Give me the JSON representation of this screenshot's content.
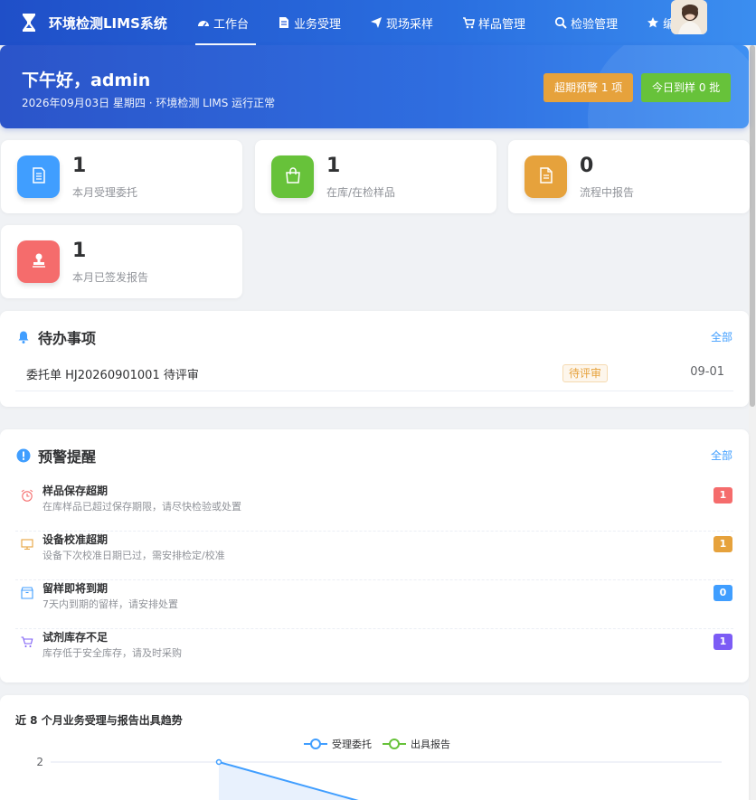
{
  "app": {
    "title": "环境检测LIMS系统"
  },
  "nav": {
    "items": [
      {
        "label": "工作台",
        "icon": "dashboard-icon",
        "active": true
      },
      {
        "label": "业务受理",
        "icon": "document-icon",
        "active": false
      },
      {
        "label": "现场采样",
        "icon": "paper-plane-icon",
        "active": false
      },
      {
        "label": "样品管理",
        "icon": "cart-icon",
        "active": false
      },
      {
        "label": "检验管理",
        "icon": "search-icon",
        "active": false
      },
      {
        "label": "编制",
        "icon": "star-icon",
        "active": false
      }
    ]
  },
  "banner": {
    "greeting": "下午好，admin",
    "subtitle": "2026年09月03日 星期四 · 环境检测 LIMS 运行正常",
    "warn_button": "超期预警 1 项",
    "today_button": "今日到样 0 批"
  },
  "stats": [
    {
      "value": "1",
      "label": "本月受理委托",
      "icon": "document-icon",
      "color": "#409eff"
    },
    {
      "value": "1",
      "label": "在库/在检样品",
      "icon": "bag-icon",
      "color": "#67c23a"
    },
    {
      "value": "0",
      "label": "流程中报告",
      "icon": "report-icon",
      "color": "#e6a23c"
    },
    {
      "value": "1",
      "label": "本月已签发报告",
      "icon": "stamp-icon",
      "color": "#f56c6c"
    }
  ],
  "todo": {
    "title": "待办事项",
    "more": "全部",
    "items": [
      {
        "text": "委托单 HJ20260901001 待评审",
        "tag": "待评审",
        "date": "09-01"
      }
    ]
  },
  "alerts": {
    "title": "预警提醒",
    "more": "全部",
    "items": [
      {
        "title": "样品保存超期",
        "desc": "在库样品已超过保存期限，请尽快检验或处置",
        "count": "1",
        "icon": "alarm-clock-icon",
        "color": "#f56c6c"
      },
      {
        "title": "设备校准超期",
        "desc": "设备下次校准日期已过，需安排检定/校准",
        "count": "1",
        "icon": "monitor-icon",
        "color": "#e6a23c"
      },
      {
        "title": "留样即将到期",
        "desc": "7天内到期的留样，请安排处置",
        "count": "0",
        "icon": "box-icon",
        "color": "#409eff"
      },
      {
        "title": "试剂库存不足",
        "desc": "库存低于安全库存，请及时采购",
        "count": "1",
        "icon": "cart-icon",
        "color": "#7c5cf5"
      }
    ]
  },
  "chart_data": {
    "type": "line",
    "title": "近 8 个月业务受理与报告出具趋势",
    "series": [
      {
        "name": "受理委托",
        "color": "#409eff"
      },
      {
        "name": "出具报告",
        "color": "#67c23a"
      }
    ],
    "y_ticks": [
      "2"
    ],
    "visible_points": [
      {
        "series": "受理委托",
        "y": 2
      }
    ]
  }
}
